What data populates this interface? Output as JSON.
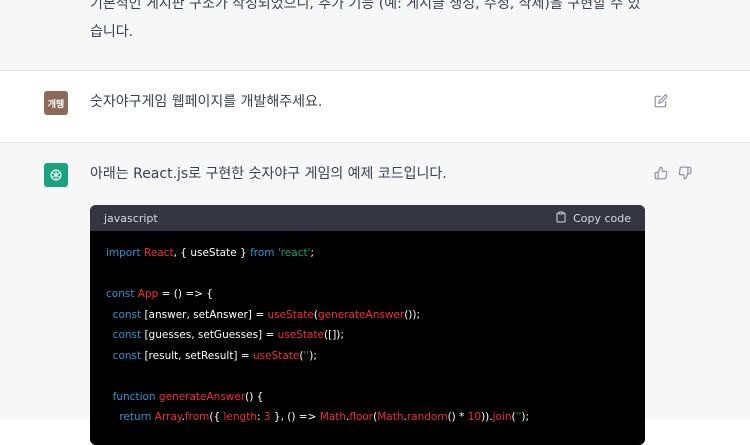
{
  "previous_message": {
    "text": "기본적인 게시판 구조가 작성되었으니, 추가 기능 (예: 게시글 생성, 수정, 삭제)을 구현할 수 있습니다."
  },
  "user_message": {
    "avatar_label": "개텡",
    "text": "숫자야구게임 웹페이지를 개발해주세요."
  },
  "assistant_message": {
    "text": "아래는 React.js로 구현한 숫자야구 게임의 예제 코드입니다."
  },
  "code_block": {
    "language": "javascript",
    "copy_label": "Copy code",
    "lines": [
      [
        {
          "t": "import",
          "c": "kw"
        },
        {
          "t": " React",
          "c": "fn"
        },
        {
          "t": ", { useState } ",
          "c": "pl"
        },
        {
          "t": "from",
          "c": "kw"
        },
        {
          "t": " 'react'",
          "c": "str"
        },
        {
          "t": ";",
          "c": "pl"
        }
      ],
      [],
      [
        {
          "t": "const",
          "c": "kw"
        },
        {
          "t": " App",
          "c": "fn"
        },
        {
          "t": " = () => {",
          "c": "pl"
        }
      ],
      [
        {
          "t": "  const",
          "c": "kw"
        },
        {
          "t": " [answer, setAnswer] = ",
          "c": "pl"
        },
        {
          "t": "useState",
          "c": "fn"
        },
        {
          "t": "(",
          "c": "pl"
        },
        {
          "t": "generateAnswer",
          "c": "fn"
        },
        {
          "t": "());",
          "c": "pl"
        }
      ],
      [
        {
          "t": "  const",
          "c": "kw"
        },
        {
          "t": " [guesses, setGuesses] = ",
          "c": "pl"
        },
        {
          "t": "useState",
          "c": "fn"
        },
        {
          "t": "([]);",
          "c": "pl"
        }
      ],
      [
        {
          "t": "  const",
          "c": "kw"
        },
        {
          "t": " [result, setResult] = ",
          "c": "pl"
        },
        {
          "t": "useState",
          "c": "fn"
        },
        {
          "t": "(",
          "c": "pl"
        },
        {
          "t": "''",
          "c": "str"
        },
        {
          "t": ");",
          "c": "pl"
        }
      ],
      [],
      [
        {
          "t": "  function",
          "c": "kw"
        },
        {
          "t": " generateAnswer",
          "c": "fn"
        },
        {
          "t": "() {",
          "c": "pl"
        }
      ],
      [
        {
          "t": "    return",
          "c": "kw"
        },
        {
          "t": " Array",
          "c": "fn"
        },
        {
          "t": ".",
          "c": "pl"
        },
        {
          "t": "from",
          "c": "fn"
        },
        {
          "t": "({ ",
          "c": "pl"
        },
        {
          "t": "length",
          "c": "fn"
        },
        {
          "t": ": ",
          "c": "pl"
        },
        {
          "t": "3",
          "c": "fn"
        },
        {
          "t": " }, () => ",
          "c": "pl"
        },
        {
          "t": "Math",
          "c": "fn"
        },
        {
          "t": ".",
          "c": "pl"
        },
        {
          "t": "floor",
          "c": "fn"
        },
        {
          "t": "(",
          "c": "pl"
        },
        {
          "t": "Math",
          "c": "fn"
        },
        {
          "t": ".",
          "c": "pl"
        },
        {
          "t": "random",
          "c": "fn"
        },
        {
          "t": "() * ",
          "c": "pl"
        },
        {
          "t": "10",
          "c": "fn"
        },
        {
          "t": ")).",
          "c": "pl"
        },
        {
          "t": "join",
          "c": "fn"
        },
        {
          "t": "(",
          "c": "pl"
        },
        {
          "t": "''",
          "c": "str"
        },
        {
          "t": ");",
          "c": "pl"
        }
      ]
    ]
  }
}
